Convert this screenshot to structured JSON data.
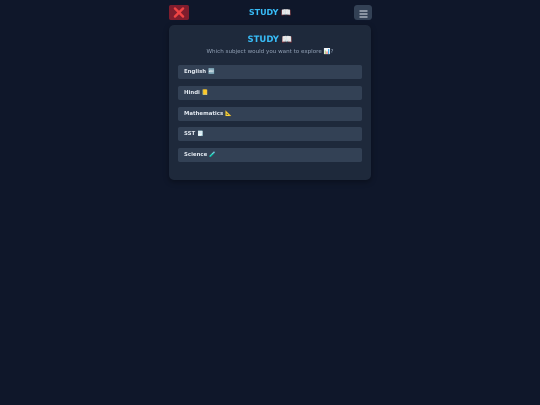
{
  "header": {
    "title": "STUDY 📖",
    "close_icon": "close-icon",
    "menu_icon": "hamburger-menu-icon"
  },
  "card": {
    "title": "STUDY 📖",
    "subtitle": "Which subject would you want to explore 📊?"
  },
  "subjects": [
    {
      "label": "English 🔤"
    },
    {
      "label": "Hindi 📒"
    },
    {
      "label": "Mathematics 📐"
    },
    {
      "label": "SST 🗒️"
    },
    {
      "label": "Science 🧪"
    }
  ],
  "colors": {
    "background": "#0f172a",
    "card": "#1e293b",
    "item": "#334155",
    "accent": "#38bdf8",
    "close_button": "#7f1d2d",
    "close_x": "#ef4444"
  }
}
